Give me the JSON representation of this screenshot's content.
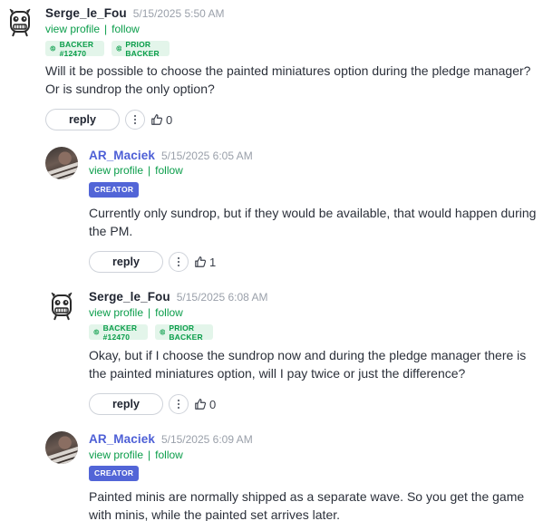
{
  "comments": [
    {
      "author": "Serge_le_Fou",
      "time": "5/15/2025 5:50 AM",
      "view_profile": "view profile",
      "sep": "|",
      "follow": "follow",
      "badges": [
        "BACKER #12470",
        "PRIOR BACKER"
      ],
      "text": "Will it be possible to choose the painted miniatures option during the pledge manager? Or is sundrop the only option?",
      "reply": "reply",
      "likes": "0"
    },
    {
      "author": "AR_Maciek",
      "time": "5/15/2025 6:05 AM",
      "view_profile": "view profile",
      "sep": "|",
      "follow": "follow",
      "creator_badge": "CREATOR",
      "text": "Currently only sundrop, but if they would be available, that would happen dur­ing the PM.",
      "reply": "reply",
      "likes": "1"
    },
    {
      "author": "Serge_le_Fou",
      "time": "5/15/2025 6:08 AM",
      "view_profile": "view profile",
      "sep": "|",
      "follow": "follow",
      "badges": [
        "BACKER #12470",
        "PRIOR BACKER"
      ],
      "text": "Okay, but if I choose the sundrop now and during the pledge manager there is the painted miniatures option, will I pay twice or just the difference?",
      "reply": "reply",
      "likes": "0"
    },
    {
      "author": "AR_Maciek",
      "time": "5/15/2025 6:09 AM",
      "view_profile": "view profile",
      "sep": "|",
      "follow": "follow",
      "creator_badge": "CREATOR",
      "text": "Painted minis are normally shipped as a separate wave. So you get the game with minis, while the painted set arrives later."
    }
  ],
  "colors": {
    "creator_name": "#4d5fd6",
    "link_green": "#0a9d4a",
    "badge_bg": "#e3f5ea",
    "creator_badge_bg": "#5265d7"
  }
}
